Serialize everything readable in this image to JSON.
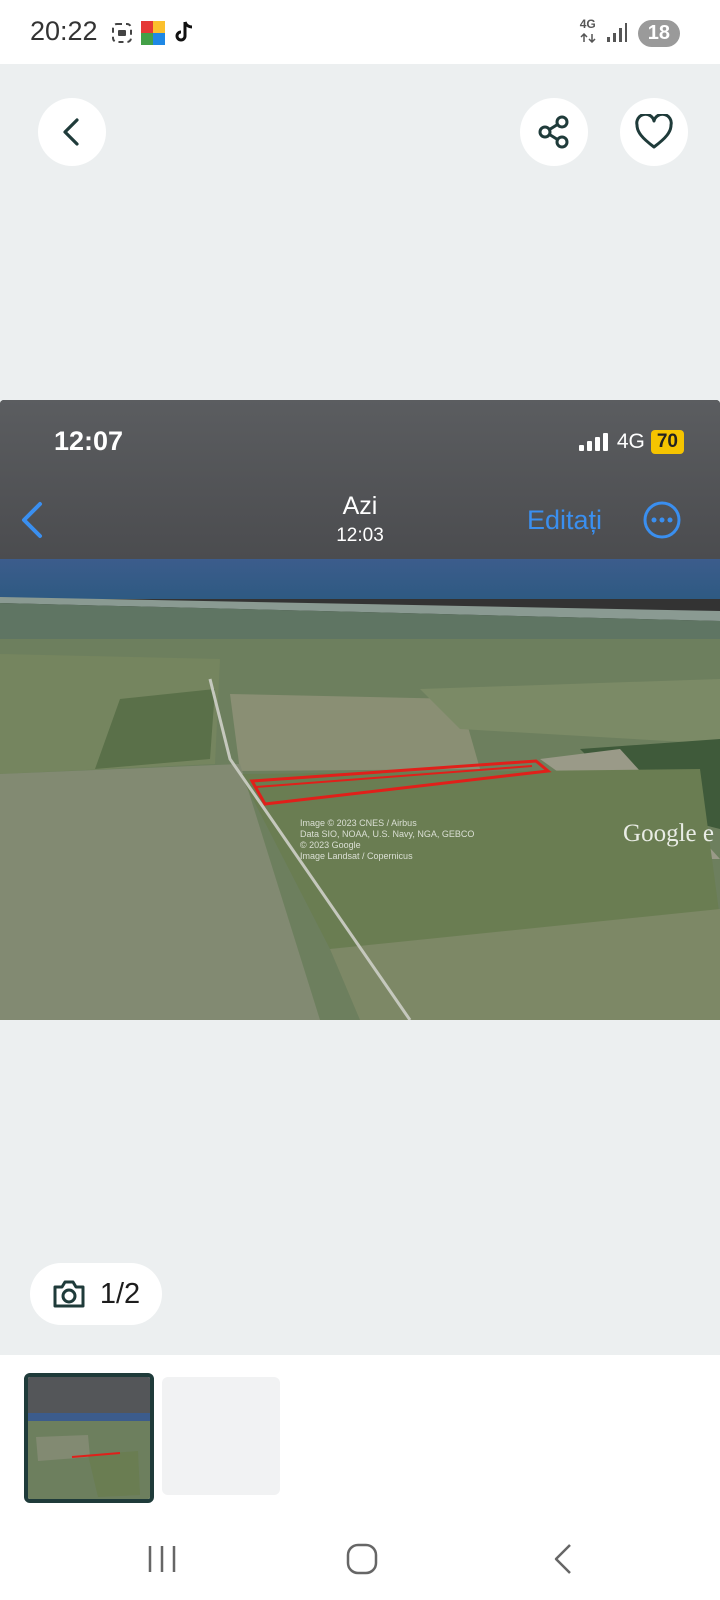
{
  "status_bar": {
    "time": "20:22",
    "network": "4G",
    "battery": "18",
    "icons": [
      "screenshot-icon",
      "app-icon",
      "tiktok-icon"
    ]
  },
  "top_bar": {
    "icons": [
      "back-icon",
      "share-icon",
      "heart-icon"
    ]
  },
  "photo": {
    "status_time": "12:07",
    "network": "4G",
    "battery": "70",
    "title": "Azi",
    "subtitle": "12:03",
    "edit_label": "Editați",
    "map_caption_lines": [
      "Image © 2023 CNES / Airbus",
      "Data SIO, NOAA, U.S. Navy, NGA, GEBCO",
      "© 2023 Google",
      "Image Landsat / Copernicus"
    ],
    "map_logo": "Google e"
  },
  "counter": {
    "label": "1/2",
    "icon": "camera-icon"
  },
  "colors": {
    "accent": "#3a8ff0",
    "selected_border": "#1f3b3a",
    "highlight_outline": "#e0201a"
  }
}
